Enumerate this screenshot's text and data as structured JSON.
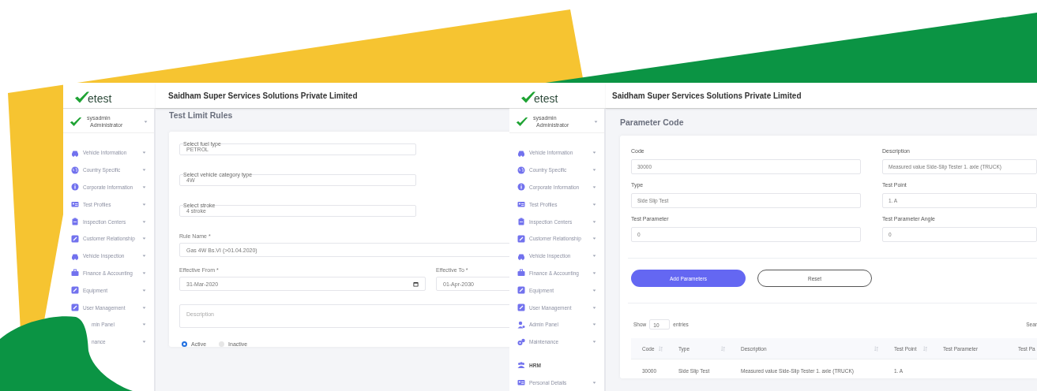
{
  "screens": [
    {
      "kind": "rules",
      "logo": "etest",
      "company": "Saidham Super Services Solutions Private Limited",
      "user": {
        "name": "sysadmin",
        "role": "Administrator"
      },
      "sidebar": {
        "items": [
          {
            "kind": "link",
            "label": "Vehicle Information"
          },
          {
            "kind": "link",
            "label": "Country Specific"
          },
          {
            "kind": "link",
            "label": "Corporate Information"
          },
          {
            "kind": "link",
            "label": "Test Profiles"
          },
          {
            "kind": "link",
            "label": "Inspection Centers"
          },
          {
            "kind": "link",
            "label": "Customer Relationship"
          },
          {
            "kind": "link",
            "label": "Vehicle Inspection"
          },
          {
            "kind": "link",
            "label": "Finance & Accounting"
          },
          {
            "kind": "link",
            "label": "Equipment"
          },
          {
            "kind": "link",
            "label": "User Management"
          },
          {
            "kind": "partial",
            "label": "min Panel"
          },
          {
            "kind": "partial",
            "label": "nance"
          }
        ]
      },
      "title": "Test Limit Rules",
      "selects": [
        {
          "label": "Select fuel type",
          "value": "PETROL"
        },
        {
          "label": "Select vehicle category type",
          "value": "4W"
        },
        {
          "label": "Select stroke",
          "value": "4 stroke"
        }
      ],
      "rule_name": {
        "label": "Rule Name *",
        "value": "Gas 4W Bs.VI (>01.04.2020)"
      },
      "effective_from": {
        "label": "Effective From *",
        "value": "31-Mar-2020"
      },
      "effective_to": {
        "label": "Effective To *",
        "value": "01-Apr-2030"
      },
      "description": {
        "placeholder": "Description"
      },
      "status": [
        {
          "label": "Active",
          "selected": true
        },
        {
          "label": "Inactive",
          "selected": false
        }
      ]
    },
    {
      "kind": "parameters",
      "logo": "etest",
      "company": "Saidham Super Services Solutions Private Limited",
      "user": {
        "name": "sysadmin",
        "role": "Administrator"
      },
      "sidebar": {
        "items": [
          {
            "kind": "link",
            "label": "Vehicle Information"
          },
          {
            "kind": "link",
            "label": "Country Specific"
          },
          {
            "kind": "link",
            "label": "Corporate Information"
          },
          {
            "kind": "link",
            "label": "Test Profiles"
          },
          {
            "kind": "link",
            "label": "Inspection Centers"
          },
          {
            "kind": "link",
            "label": "Customer Relationship"
          },
          {
            "kind": "link",
            "label": "Vehicle Inspection"
          },
          {
            "kind": "link",
            "label": "Finance & Accounting"
          },
          {
            "kind": "link",
            "label": "Equipment"
          },
          {
            "kind": "link",
            "label": "User Management"
          },
          {
            "kind": "link",
            "label": "Admin Panel"
          },
          {
            "kind": "link",
            "label": "Maintenance"
          },
          {
            "kind": "section",
            "label": "HRM"
          },
          {
            "kind": "link",
            "label": "Personal Details"
          }
        ]
      },
      "title": "Parameter Code",
      "fields": [
        {
          "label": "Code",
          "value": "30000"
        },
        {
          "label": "Description",
          "value": "Measured value Side-Slip Tester 1. axle (TRUCK)"
        },
        {
          "label": "Type",
          "value": "Side Slip Test"
        },
        {
          "label": "Test Point",
          "value": "1. A"
        },
        {
          "label": "Test Parameter",
          "value": "0"
        },
        {
          "label": "Test Parameter Angle",
          "value": "0"
        }
      ],
      "buttons": [
        {
          "kind": "primary",
          "label": "Add Parameters"
        },
        {
          "kind": "outline",
          "label": "Reset"
        }
      ],
      "length": {
        "before": "Show",
        "value": "10",
        "after": "entries"
      },
      "search": {
        "label": "Sear"
      },
      "table": {
        "columns": [
          {
            "label": "Code",
            "sortable": true
          },
          {
            "label": "Type",
            "sortable": true
          },
          {
            "label": "Description",
            "sortable": true
          },
          {
            "label": "Test Point",
            "sortable": true
          },
          {
            "label": "Test Parameter",
            "sortable": false
          },
          {
            "label": "Test Pa"
          }
        ],
        "rows": [
          [
            "30000",
            "Side Slip Test",
            "Measured value Side-Slip Tester 1. axle (TRUCK)",
            "1. A"
          ]
        ]
      }
    }
  ]
}
